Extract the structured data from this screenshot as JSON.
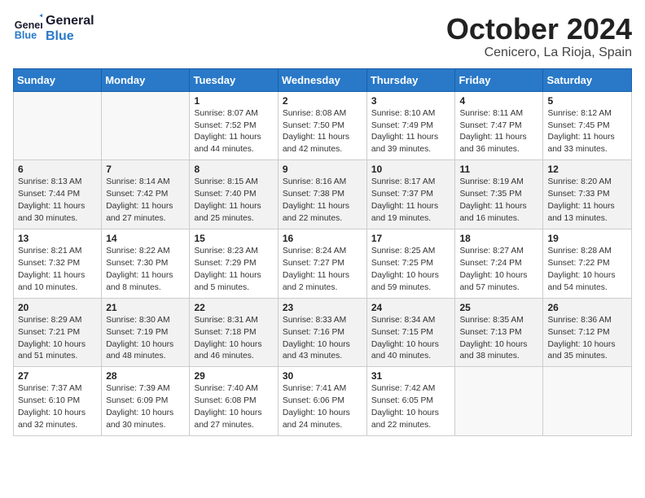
{
  "header": {
    "logo_line1": "General",
    "logo_line2": "Blue",
    "month": "October 2024",
    "location": "Cenicero, La Rioja, Spain"
  },
  "days_of_week": [
    "Sunday",
    "Monday",
    "Tuesday",
    "Wednesday",
    "Thursday",
    "Friday",
    "Saturday"
  ],
  "weeks": [
    [
      {
        "day": "",
        "info": ""
      },
      {
        "day": "",
        "info": ""
      },
      {
        "day": "1",
        "info": "Sunrise: 8:07 AM\nSunset: 7:52 PM\nDaylight: 11 hours and 44 minutes."
      },
      {
        "day": "2",
        "info": "Sunrise: 8:08 AM\nSunset: 7:50 PM\nDaylight: 11 hours and 42 minutes."
      },
      {
        "day": "3",
        "info": "Sunrise: 8:10 AM\nSunset: 7:49 PM\nDaylight: 11 hours and 39 minutes."
      },
      {
        "day": "4",
        "info": "Sunrise: 8:11 AM\nSunset: 7:47 PM\nDaylight: 11 hours and 36 minutes."
      },
      {
        "day": "5",
        "info": "Sunrise: 8:12 AM\nSunset: 7:45 PM\nDaylight: 11 hours and 33 minutes."
      }
    ],
    [
      {
        "day": "6",
        "info": "Sunrise: 8:13 AM\nSunset: 7:44 PM\nDaylight: 11 hours and 30 minutes."
      },
      {
        "day": "7",
        "info": "Sunrise: 8:14 AM\nSunset: 7:42 PM\nDaylight: 11 hours and 27 minutes."
      },
      {
        "day": "8",
        "info": "Sunrise: 8:15 AM\nSunset: 7:40 PM\nDaylight: 11 hours and 25 minutes."
      },
      {
        "day": "9",
        "info": "Sunrise: 8:16 AM\nSunset: 7:38 PM\nDaylight: 11 hours and 22 minutes."
      },
      {
        "day": "10",
        "info": "Sunrise: 8:17 AM\nSunset: 7:37 PM\nDaylight: 11 hours and 19 minutes."
      },
      {
        "day": "11",
        "info": "Sunrise: 8:19 AM\nSunset: 7:35 PM\nDaylight: 11 hours and 16 minutes."
      },
      {
        "day": "12",
        "info": "Sunrise: 8:20 AM\nSunset: 7:33 PM\nDaylight: 11 hours and 13 minutes."
      }
    ],
    [
      {
        "day": "13",
        "info": "Sunrise: 8:21 AM\nSunset: 7:32 PM\nDaylight: 11 hours and 10 minutes."
      },
      {
        "day": "14",
        "info": "Sunrise: 8:22 AM\nSunset: 7:30 PM\nDaylight: 11 hours and 8 minutes."
      },
      {
        "day": "15",
        "info": "Sunrise: 8:23 AM\nSunset: 7:29 PM\nDaylight: 11 hours and 5 minutes."
      },
      {
        "day": "16",
        "info": "Sunrise: 8:24 AM\nSunset: 7:27 PM\nDaylight: 11 hours and 2 minutes."
      },
      {
        "day": "17",
        "info": "Sunrise: 8:25 AM\nSunset: 7:25 PM\nDaylight: 10 hours and 59 minutes."
      },
      {
        "day": "18",
        "info": "Sunrise: 8:27 AM\nSunset: 7:24 PM\nDaylight: 10 hours and 57 minutes."
      },
      {
        "day": "19",
        "info": "Sunrise: 8:28 AM\nSunset: 7:22 PM\nDaylight: 10 hours and 54 minutes."
      }
    ],
    [
      {
        "day": "20",
        "info": "Sunrise: 8:29 AM\nSunset: 7:21 PM\nDaylight: 10 hours and 51 minutes."
      },
      {
        "day": "21",
        "info": "Sunrise: 8:30 AM\nSunset: 7:19 PM\nDaylight: 10 hours and 48 minutes."
      },
      {
        "day": "22",
        "info": "Sunrise: 8:31 AM\nSunset: 7:18 PM\nDaylight: 10 hours and 46 minutes."
      },
      {
        "day": "23",
        "info": "Sunrise: 8:33 AM\nSunset: 7:16 PM\nDaylight: 10 hours and 43 minutes."
      },
      {
        "day": "24",
        "info": "Sunrise: 8:34 AM\nSunset: 7:15 PM\nDaylight: 10 hours and 40 minutes."
      },
      {
        "day": "25",
        "info": "Sunrise: 8:35 AM\nSunset: 7:13 PM\nDaylight: 10 hours and 38 minutes."
      },
      {
        "day": "26",
        "info": "Sunrise: 8:36 AM\nSunset: 7:12 PM\nDaylight: 10 hours and 35 minutes."
      }
    ],
    [
      {
        "day": "27",
        "info": "Sunrise: 7:37 AM\nSunset: 6:10 PM\nDaylight: 10 hours and 32 minutes."
      },
      {
        "day": "28",
        "info": "Sunrise: 7:39 AM\nSunset: 6:09 PM\nDaylight: 10 hours and 30 minutes."
      },
      {
        "day": "29",
        "info": "Sunrise: 7:40 AM\nSunset: 6:08 PM\nDaylight: 10 hours and 27 minutes."
      },
      {
        "day": "30",
        "info": "Sunrise: 7:41 AM\nSunset: 6:06 PM\nDaylight: 10 hours and 24 minutes."
      },
      {
        "day": "31",
        "info": "Sunrise: 7:42 AM\nSunset: 6:05 PM\nDaylight: 10 hours and 22 minutes."
      },
      {
        "day": "",
        "info": ""
      },
      {
        "day": "",
        "info": ""
      }
    ]
  ]
}
